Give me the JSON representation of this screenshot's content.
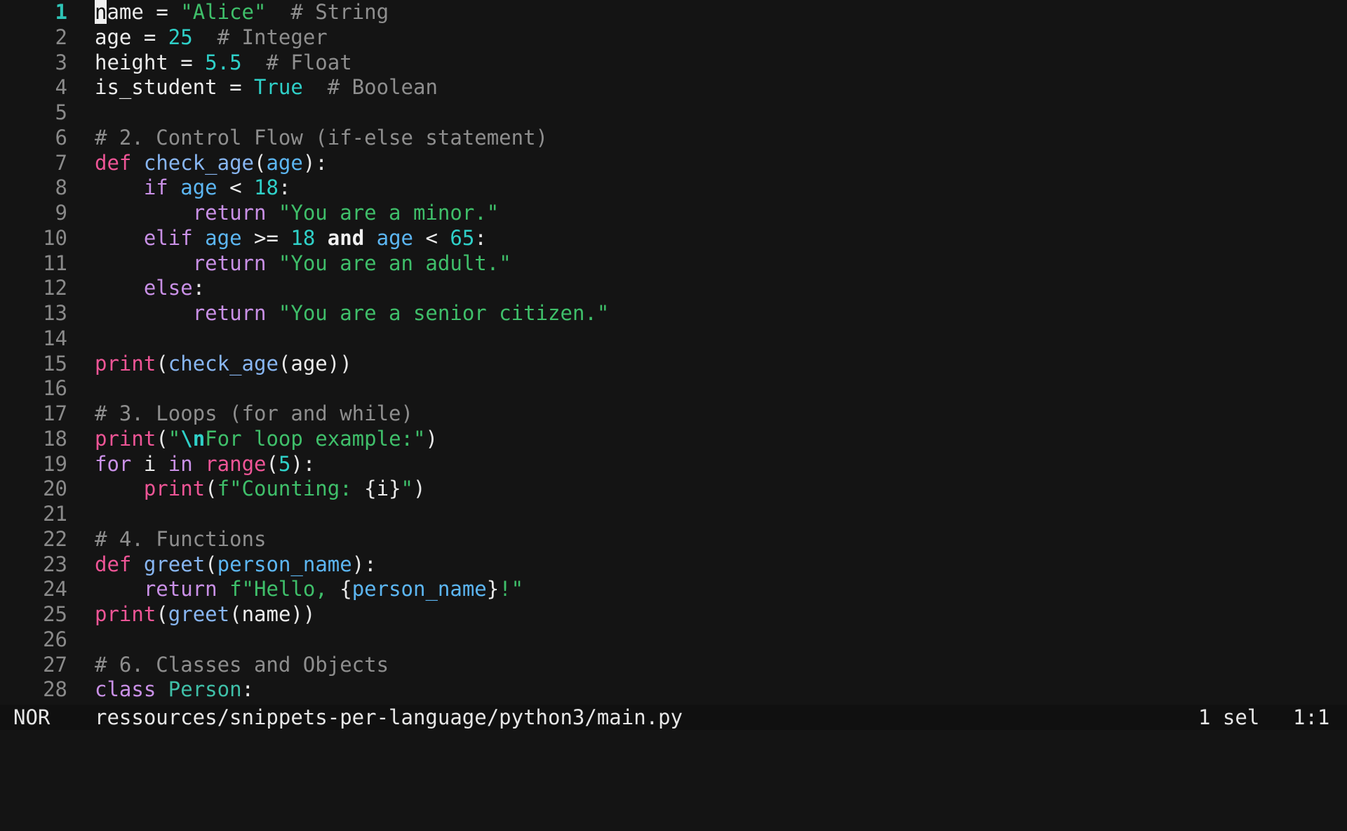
{
  "editor": {
    "lines": [
      {
        "n": "1",
        "current": true,
        "tokens": [
          [
            "cursor",
            "n"
          ],
          [
            "var",
            "ame"
          ],
          [
            "op",
            " = "
          ],
          [
            "str",
            "\"Alice\""
          ],
          [
            "op",
            "  "
          ],
          [
            "com",
            "# String"
          ]
        ]
      },
      {
        "n": "2",
        "tokens": [
          [
            "var",
            "age"
          ],
          [
            "op",
            " = "
          ],
          [
            "num",
            "25"
          ],
          [
            "op",
            "  "
          ],
          [
            "com",
            "# Integer"
          ]
        ]
      },
      {
        "n": "3",
        "tokens": [
          [
            "var",
            "height"
          ],
          [
            "op",
            " = "
          ],
          [
            "num",
            "5.5"
          ],
          [
            "op",
            "  "
          ],
          [
            "com",
            "# Float"
          ]
        ]
      },
      {
        "n": "4",
        "tokens": [
          [
            "var",
            "is_student"
          ],
          [
            "op",
            " = "
          ],
          [
            "const",
            "True"
          ],
          [
            "op",
            "  "
          ],
          [
            "com",
            "# Boolean"
          ]
        ]
      },
      {
        "n": "5",
        "tokens": []
      },
      {
        "n": "6",
        "tokens": [
          [
            "com",
            "# 2. Control Flow (if-else statement)"
          ]
        ]
      },
      {
        "n": "7",
        "tokens": [
          [
            "kw",
            "def"
          ],
          [
            "op",
            " "
          ],
          [
            "fn",
            "check_age"
          ],
          [
            "punc",
            "("
          ],
          [
            "param",
            "age"
          ],
          [
            "punc",
            "):"
          ]
        ]
      },
      {
        "n": "8",
        "tokens": [
          [
            "op",
            "    "
          ],
          [
            "kw2",
            "if"
          ],
          [
            "op",
            " "
          ],
          [
            "param",
            "age"
          ],
          [
            "op",
            " < "
          ],
          [
            "num",
            "18"
          ],
          [
            "punc",
            ":"
          ]
        ]
      },
      {
        "n": "9",
        "tokens": [
          [
            "op",
            "        "
          ],
          [
            "kw2",
            "return"
          ],
          [
            "op",
            " "
          ],
          [
            "str",
            "\"You are a minor.\""
          ]
        ]
      },
      {
        "n": "10",
        "tokens": [
          [
            "op",
            "    "
          ],
          [
            "kw2",
            "elif"
          ],
          [
            "op",
            " "
          ],
          [
            "param",
            "age"
          ],
          [
            "op",
            " >= "
          ],
          [
            "num",
            "18"
          ],
          [
            "op",
            " "
          ],
          [
            "bold",
            "and"
          ],
          [
            "op",
            " "
          ],
          [
            "param",
            "age"
          ],
          [
            "op",
            " < "
          ],
          [
            "num",
            "65"
          ],
          [
            "punc",
            ":"
          ]
        ]
      },
      {
        "n": "11",
        "tokens": [
          [
            "op",
            "        "
          ],
          [
            "kw2",
            "return"
          ],
          [
            "op",
            " "
          ],
          [
            "str",
            "\"You are an adult.\""
          ]
        ]
      },
      {
        "n": "12",
        "tokens": [
          [
            "op",
            "    "
          ],
          [
            "kw2",
            "else"
          ],
          [
            "punc",
            ":"
          ]
        ]
      },
      {
        "n": "13",
        "tokens": [
          [
            "op",
            "        "
          ],
          [
            "kw2",
            "return"
          ],
          [
            "op",
            " "
          ],
          [
            "str",
            "\"You are a senior citizen.\""
          ]
        ]
      },
      {
        "n": "14",
        "tokens": []
      },
      {
        "n": "15",
        "tokens": [
          [
            "builtin",
            "print"
          ],
          [
            "punc",
            "("
          ],
          [
            "fn",
            "check_age"
          ],
          [
            "punc",
            "("
          ],
          [
            "var",
            "age"
          ],
          [
            "punc",
            "))"
          ]
        ]
      },
      {
        "n": "16",
        "tokens": []
      },
      {
        "n": "17",
        "tokens": [
          [
            "com",
            "# 3. Loops (for and while)"
          ]
        ]
      },
      {
        "n": "18",
        "tokens": [
          [
            "builtin",
            "print"
          ],
          [
            "punc",
            "("
          ],
          [
            "str",
            "\""
          ],
          [
            "esc",
            "\\n"
          ],
          [
            "str",
            "For loop example:\""
          ],
          [
            "punc",
            ")"
          ]
        ]
      },
      {
        "n": "19",
        "tokens": [
          [
            "kw2",
            "for"
          ],
          [
            "op",
            " "
          ],
          [
            "var",
            "i"
          ],
          [
            "op",
            " "
          ],
          [
            "kw2",
            "in"
          ],
          [
            "op",
            " "
          ],
          [
            "builtin",
            "range"
          ],
          [
            "punc",
            "("
          ],
          [
            "num",
            "5"
          ],
          [
            "punc",
            "):"
          ]
        ]
      },
      {
        "n": "20",
        "tokens": [
          [
            "op",
            "    "
          ],
          [
            "builtin",
            "print"
          ],
          [
            "punc",
            "("
          ],
          [
            "str",
            "f\"Counting: "
          ],
          [
            "brace",
            "{"
          ],
          [
            "var",
            "i"
          ],
          [
            "brace",
            "}"
          ],
          [
            "str",
            "\""
          ],
          [
            "punc",
            ")"
          ]
        ]
      },
      {
        "n": "21",
        "tokens": []
      },
      {
        "n": "22",
        "tokens": [
          [
            "com",
            "# 4. Functions"
          ]
        ]
      },
      {
        "n": "23",
        "tokens": [
          [
            "kw",
            "def"
          ],
          [
            "op",
            " "
          ],
          [
            "fn",
            "greet"
          ],
          [
            "punc",
            "("
          ],
          [
            "param",
            "person_name"
          ],
          [
            "punc",
            "):"
          ]
        ]
      },
      {
        "n": "24",
        "tokens": [
          [
            "op",
            "    "
          ],
          [
            "kw2",
            "return"
          ],
          [
            "op",
            " "
          ],
          [
            "str",
            "f\"Hello, "
          ],
          [
            "brace",
            "{"
          ],
          [
            "param",
            "person_name"
          ],
          [
            "brace",
            "}"
          ],
          [
            "str",
            "!\""
          ]
        ]
      },
      {
        "n": "25",
        "tokens": [
          [
            "builtin",
            "print"
          ],
          [
            "punc",
            "("
          ],
          [
            "fn",
            "greet"
          ],
          [
            "punc",
            "("
          ],
          [
            "var",
            "name"
          ],
          [
            "punc",
            "))"
          ]
        ]
      },
      {
        "n": "26",
        "tokens": []
      },
      {
        "n": "27",
        "tokens": [
          [
            "com",
            "# 6. Classes and Objects"
          ]
        ]
      },
      {
        "n": "28",
        "tokens": [
          [
            "kw2",
            "class"
          ],
          [
            "op",
            " "
          ],
          [
            "cls",
            "Person"
          ],
          [
            "punc",
            ":"
          ]
        ]
      }
    ]
  },
  "statusbar": {
    "mode": "NOR",
    "filepath": "ressources/snippets-per-language/python3/main.py",
    "selection": "1 sel",
    "position": "1:1"
  },
  "colors": {
    "background": "#141414",
    "line_number": "#8a8a8a",
    "current_line_number": "#2ec4b6",
    "string": "#3fbf6a",
    "number": "#2fd0c8",
    "comment": "#8e8e8e",
    "keyword_def": "#ee5596",
    "keyword": "#c990e6",
    "function": "#88b6f2"
  }
}
